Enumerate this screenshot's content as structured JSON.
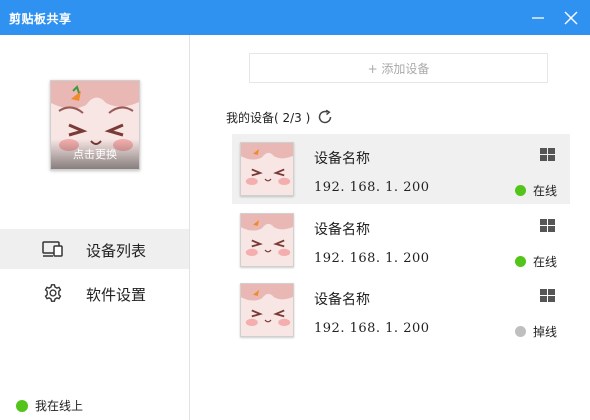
{
  "window": {
    "title": "剪贴板共享"
  },
  "sidebar": {
    "avatar_hint": "点击更换",
    "nav": [
      {
        "label": "设备列表",
        "icon": "devices-icon"
      },
      {
        "label": "软件设置",
        "icon": "gear-icon"
      }
    ],
    "self_status": {
      "label": "我在线上",
      "color": "#52c41a"
    }
  },
  "main": {
    "add_device_label": "+ 添加设备",
    "section_title": "我的设备( 2/3 )",
    "devices": [
      {
        "name": "设备名称",
        "ip": "192. 168. 1. 200",
        "os_icon": "windows-icon",
        "status": "在线",
        "status_color": "#52c41a"
      },
      {
        "name": "设备名称",
        "ip": "192. 168. 1. 200",
        "os_icon": "windows-icon",
        "status": "在线",
        "status_color": "#52c41a"
      },
      {
        "name": "设备名称",
        "ip": "192. 168. 1. 200",
        "os_icon": "windows-icon",
        "status": "掉线",
        "status_color": "#bfbfbf"
      }
    ]
  },
  "colors": {
    "titlebar": "#2f91f0",
    "online": "#52c41a",
    "offline": "#bfbfbf"
  }
}
